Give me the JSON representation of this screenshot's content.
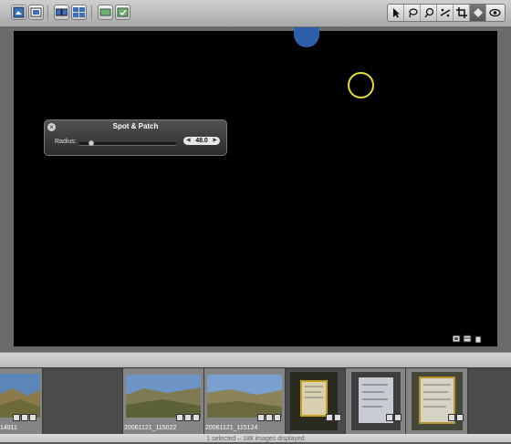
{
  "toolbar": {
    "left_buttons": [
      "view-icon",
      "fullscreen-icon",
      "split-view-icon",
      "multi-view-icon",
      "filmstrip-icon",
      "loupe-icon"
    ],
    "tools": [
      "select-arrow-icon",
      "lasso-icon",
      "patch-icon",
      "straighten-icon",
      "crop-icon",
      "stamp-icon",
      "eye-icon"
    ],
    "active_tool": "stamp-icon"
  },
  "panel": {
    "title": "Spot & Patch",
    "radius_label": "Radius:",
    "radius_value": "48.0",
    "slider_position": 0.1
  },
  "filmstrip": {
    "captions": [
      "14911",
      "20061121_115022",
      "20061121_115124"
    ]
  },
  "status": {
    "text": "1 selected – 188 images displayed"
  },
  "colors": {
    "viewer_bg": "#000000",
    "spot_blue": "#2d5ea8",
    "spot_yellow": "#e7dc36",
    "panel_bg": "#3b3b3b"
  }
}
